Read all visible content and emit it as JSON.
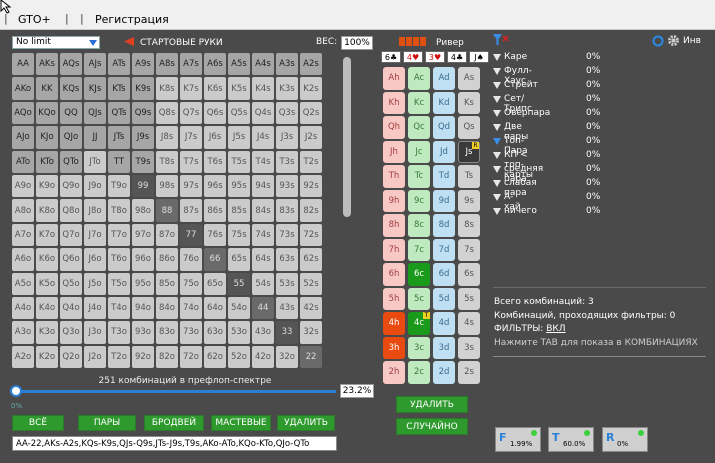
{
  "menu": {
    "items": [
      "GTO+",
      "Регистрация"
    ]
  },
  "range_panel": {
    "mode_select": "No limit",
    "start_hands_label": "СТАРТОВЫЕ РУКИ",
    "weight_label": "ВЕС:",
    "weight_value": "100%",
    "combos_caption": "251 комбинаций в префлоп-спектре",
    "slider_min": "0%",
    "percent_value": "23.2%",
    "buttons": {
      "all": "ВСЁ",
      "pairs": "ПАРЫ",
      "broadways": "БРОДВЕЙ",
      "suited": "МАСТЕВЫЕ",
      "delete": "УДАЛИТЬ"
    },
    "range_text": "AA-22,AKs-A2s,KQs-K9s,QJs-Q9s,JTs-J9s,T9s,AKo-ATo,KQo-KTo,QJo-QTo",
    "grid": [
      [
        "AA",
        "AKs",
        "AQs",
        "AJs",
        "ATs",
        "A9s",
        "A8s",
        "A7s",
        "A6s",
        "A5s",
        "A4s",
        "A3s",
        "A2s"
      ],
      [
        "AKo",
        "KK",
        "KQs",
        "KJs",
        "KTs",
        "K9s",
        "K8s",
        "K7s",
        "K6s",
        "K5s",
        "K4s",
        "K3s",
        "K2s"
      ],
      [
        "AQo",
        "KQo",
        "QQ",
        "QJs",
        "QTs",
        "Q9s",
        "Q8s",
        "Q7s",
        "Q6s",
        "Q5s",
        "Q4s",
        "Q3s",
        "Q2s"
      ],
      [
        "AJo",
        "KJo",
        "QJo",
        "JJ",
        "JTs",
        "J9s",
        "J8s",
        "J7s",
        "J6s",
        "J5s",
        "J4s",
        "J3s",
        "J2s"
      ],
      [
        "ATo",
        "KTo",
        "QTo",
        "JTo",
        "TT",
        "T9s",
        "T8s",
        "T7s",
        "T6s",
        "T5s",
        "T4s",
        "T3s",
        "T2s"
      ],
      [
        "A9o",
        "K9o",
        "Q9o",
        "J9o",
        "T9o",
        "99",
        "98s",
        "97s",
        "96s",
        "95s",
        "94s",
        "93s",
        "92s"
      ],
      [
        "A8o",
        "K8o",
        "Q8o",
        "J8o",
        "T8o",
        "98o",
        "88",
        "87s",
        "86s",
        "85s",
        "84s",
        "83s",
        "82s"
      ],
      [
        "A7o",
        "K7o",
        "Q7o",
        "J7o",
        "T7o",
        "97o",
        "87o",
        "77",
        "76s",
        "75s",
        "74s",
        "73s",
        "72s"
      ],
      [
        "A6o",
        "K6o",
        "Q6o",
        "J6o",
        "T6o",
        "96o",
        "86o",
        "76o",
        "66",
        "65s",
        "64s",
        "63s",
        "62s"
      ],
      [
        "A5o",
        "K5o",
        "Q5o",
        "J5o",
        "T5o",
        "95o",
        "85o",
        "75o",
        "65o",
        "55",
        "54s",
        "53s",
        "52s"
      ],
      [
        "A4o",
        "K4o",
        "Q4o",
        "J4o",
        "T4o",
        "94o",
        "84o",
        "74o",
        "64o",
        "54o",
        "44",
        "43s",
        "42s"
      ],
      [
        "A3o",
        "K3o",
        "Q3o",
        "J3o",
        "T3o",
        "93o",
        "83o",
        "73o",
        "63o",
        "53o",
        "43o",
        "33",
        "32s"
      ],
      [
        "A2o",
        "K2o",
        "Q2o",
        "J2o",
        "T2o",
        "92o",
        "82o",
        "72o",
        "62o",
        "52o",
        "42o",
        "32o",
        "22"
      ]
    ],
    "selected": [
      "AA",
      "AKs",
      "AQs",
      "AJs",
      "ATs",
      "A9s",
      "A8s",
      "A7s",
      "A6s",
      "A5s",
      "A4s",
      "A3s",
      "A2s",
      "AKo",
      "KK",
      "KQs",
      "KJs",
      "KTs",
      "K9s",
      "AQo",
      "KQo",
      "QQ",
      "QJs",
      "QTs",
      "Q9s",
      "AJo",
      "KJo",
      "QJo",
      "JJ",
      "JTs",
      "J9s",
      "ATo",
      "KTo",
      "QTo",
      "TT",
      "T9s",
      "99",
      "88",
      "77",
      "66",
      "55",
      "44",
      "33",
      "22"
    ]
  },
  "board": {
    "label": "Ривер",
    "cards": [
      {
        "rank": "6",
        "suit": "♣",
        "red": false
      },
      {
        "rank": "4",
        "suit": "♥",
        "red": true
      },
      {
        "rank": "3",
        "suit": "♥",
        "red": true
      },
      {
        "rank": "4",
        "suit": "♣",
        "red": false
      },
      {
        "rank": "J",
        "suit": "♠",
        "red": false
      }
    ],
    "deck_ranks": [
      "A",
      "K",
      "Q",
      "J",
      "T",
      "9",
      "8",
      "7",
      "6",
      "5",
      "4",
      "3",
      "2"
    ],
    "delete_label": "УДАЛИТЬ",
    "random_label": "СЛУЧАЙНО"
  },
  "stats": {
    "inv_label": "Инв",
    "rows": [
      {
        "label": "Каре",
        "pct": "0%"
      },
      {
        "label": "Фулл-Хаус",
        "pct": "0%"
      },
      {
        "label": "Стрейт",
        "pct": "0%"
      },
      {
        "label": "Сет/Трипс",
        "pct": "0%"
      },
      {
        "label": "Оверпара",
        "pct": "0%"
      },
      {
        "label": "Две пары",
        "pct": "0%"
      },
      {
        "label": "Топ-Пара",
        "pct": "0%"
      },
      {
        "label": "КП < топ-карты",
        "pct": "0%"
      },
      {
        "label": "средняя пара",
        "pct": "0%"
      },
      {
        "label": "слабая пара",
        "pct": "0%"
      },
      {
        "label": "А-хай",
        "pct": "0%"
      },
      {
        "label": "ничего",
        "pct": "0%"
      }
    ],
    "total_combos": "Всего комбинаций: 3",
    "filtered_combos": "Комбинаций, проходящих фильтры: 0",
    "filters_label": "ФИЛЬТРЫ:",
    "filters_value": "ВКЛ",
    "tab_hint": "Нажмите TAB для показа в КОМБИНАЦИЯХ"
  },
  "filter_buttons": [
    {
      "letter": "F",
      "value": "1.99%"
    },
    {
      "letter": "T",
      "value": "60.0%"
    },
    {
      "letter": "R",
      "value": "0%"
    }
  ]
}
